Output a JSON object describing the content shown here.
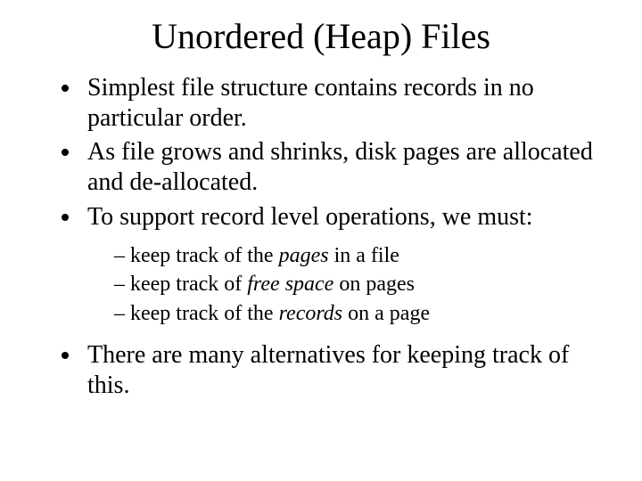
{
  "title": "Unordered (Heap) Files",
  "bullets": {
    "b1": "Simplest file structure contains records in no particular order.",
    "b2": "As file grows and shrinks, disk pages are allocated and de-allocated.",
    "b3": "To support record level operations, we must:",
    "b4": "There are many alternatives for keeping track of this."
  },
  "sub": {
    "s1a": "keep track of the ",
    "s1b": "pages",
    "s1c": " in a file",
    "s2a": "keep track of ",
    "s2b": "free space",
    "s2c": " on pages",
    "s3a": "keep track of the ",
    "s3b": "records",
    "s3c": " on a page"
  }
}
